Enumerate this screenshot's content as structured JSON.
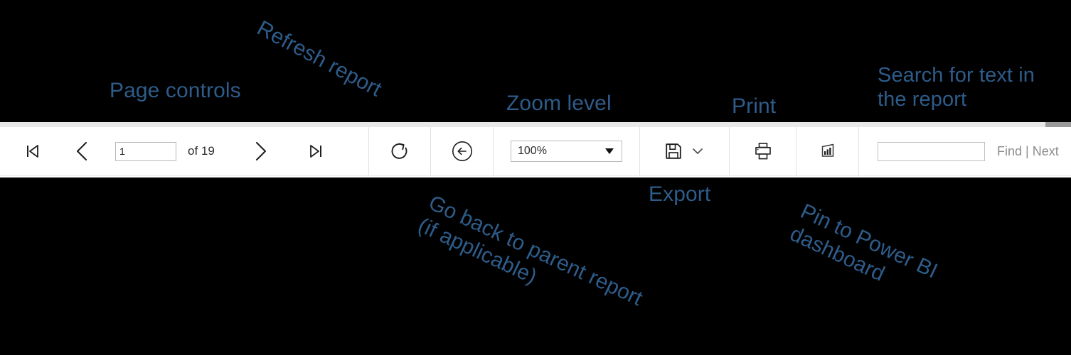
{
  "background_color": "#000000",
  "annotation_color": "#2e5c8a",
  "annotations": [
    {
      "id": "page-controls",
      "text": "Page controls",
      "rotation": 0
    },
    {
      "id": "refresh-report",
      "text": "Refresh report",
      "rotation": 28
    },
    {
      "id": "zoom-level",
      "text": "Zoom level",
      "rotation": 0
    },
    {
      "id": "print",
      "text": "Print",
      "rotation": 0
    },
    {
      "id": "search-for-text",
      "text": "Search for text in\nthe report",
      "rotation": 0
    },
    {
      "id": "go-back",
      "text": "Go back to parent report\n(if applicable)",
      "rotation": 25
    },
    {
      "id": "export",
      "text": "Export",
      "rotation": 0
    },
    {
      "id": "pin-to-powerbi",
      "text": "Pin to Power BI\ndashboard",
      "rotation": 25
    }
  ],
  "toolbar": {
    "scrollbar": {
      "name": "horizontal-scrollbar",
      "track_color": "#e8e8e8",
      "thumb_color": "#9a9a9a"
    },
    "page_controls": {
      "first_page_icon": "first-page-icon",
      "previous_page_icon": "previous-page-icon",
      "page_number_value": "1",
      "page_number_placeholder": "",
      "of_label": "of 19",
      "total_pages": "19",
      "next_page_icon": "next-page-icon",
      "last_page_icon": "last-page-icon"
    },
    "refresh": {
      "icon": "refresh-icon",
      "tooltip": "Refresh report"
    },
    "back": {
      "icon": "back-arrow-circle-icon",
      "tooltip": "Go back to parent report"
    },
    "zoom": {
      "value": "100%",
      "caret_icon": "chevron-down-icon",
      "options": [
        "100%"
      ]
    },
    "export": {
      "icon": "save-floppy-icon",
      "caret_icon": "chevron-down-icon",
      "tooltip": "Export"
    },
    "print": {
      "icon": "printer-icon",
      "tooltip": "Print"
    },
    "pin": {
      "icon": "power-bi-pin-icon",
      "tooltip": "Pin to Power BI dashboard"
    },
    "find": {
      "value": "",
      "placeholder": "",
      "find_label": "Find",
      "separator": "|",
      "next_label": "Next"
    }
  }
}
